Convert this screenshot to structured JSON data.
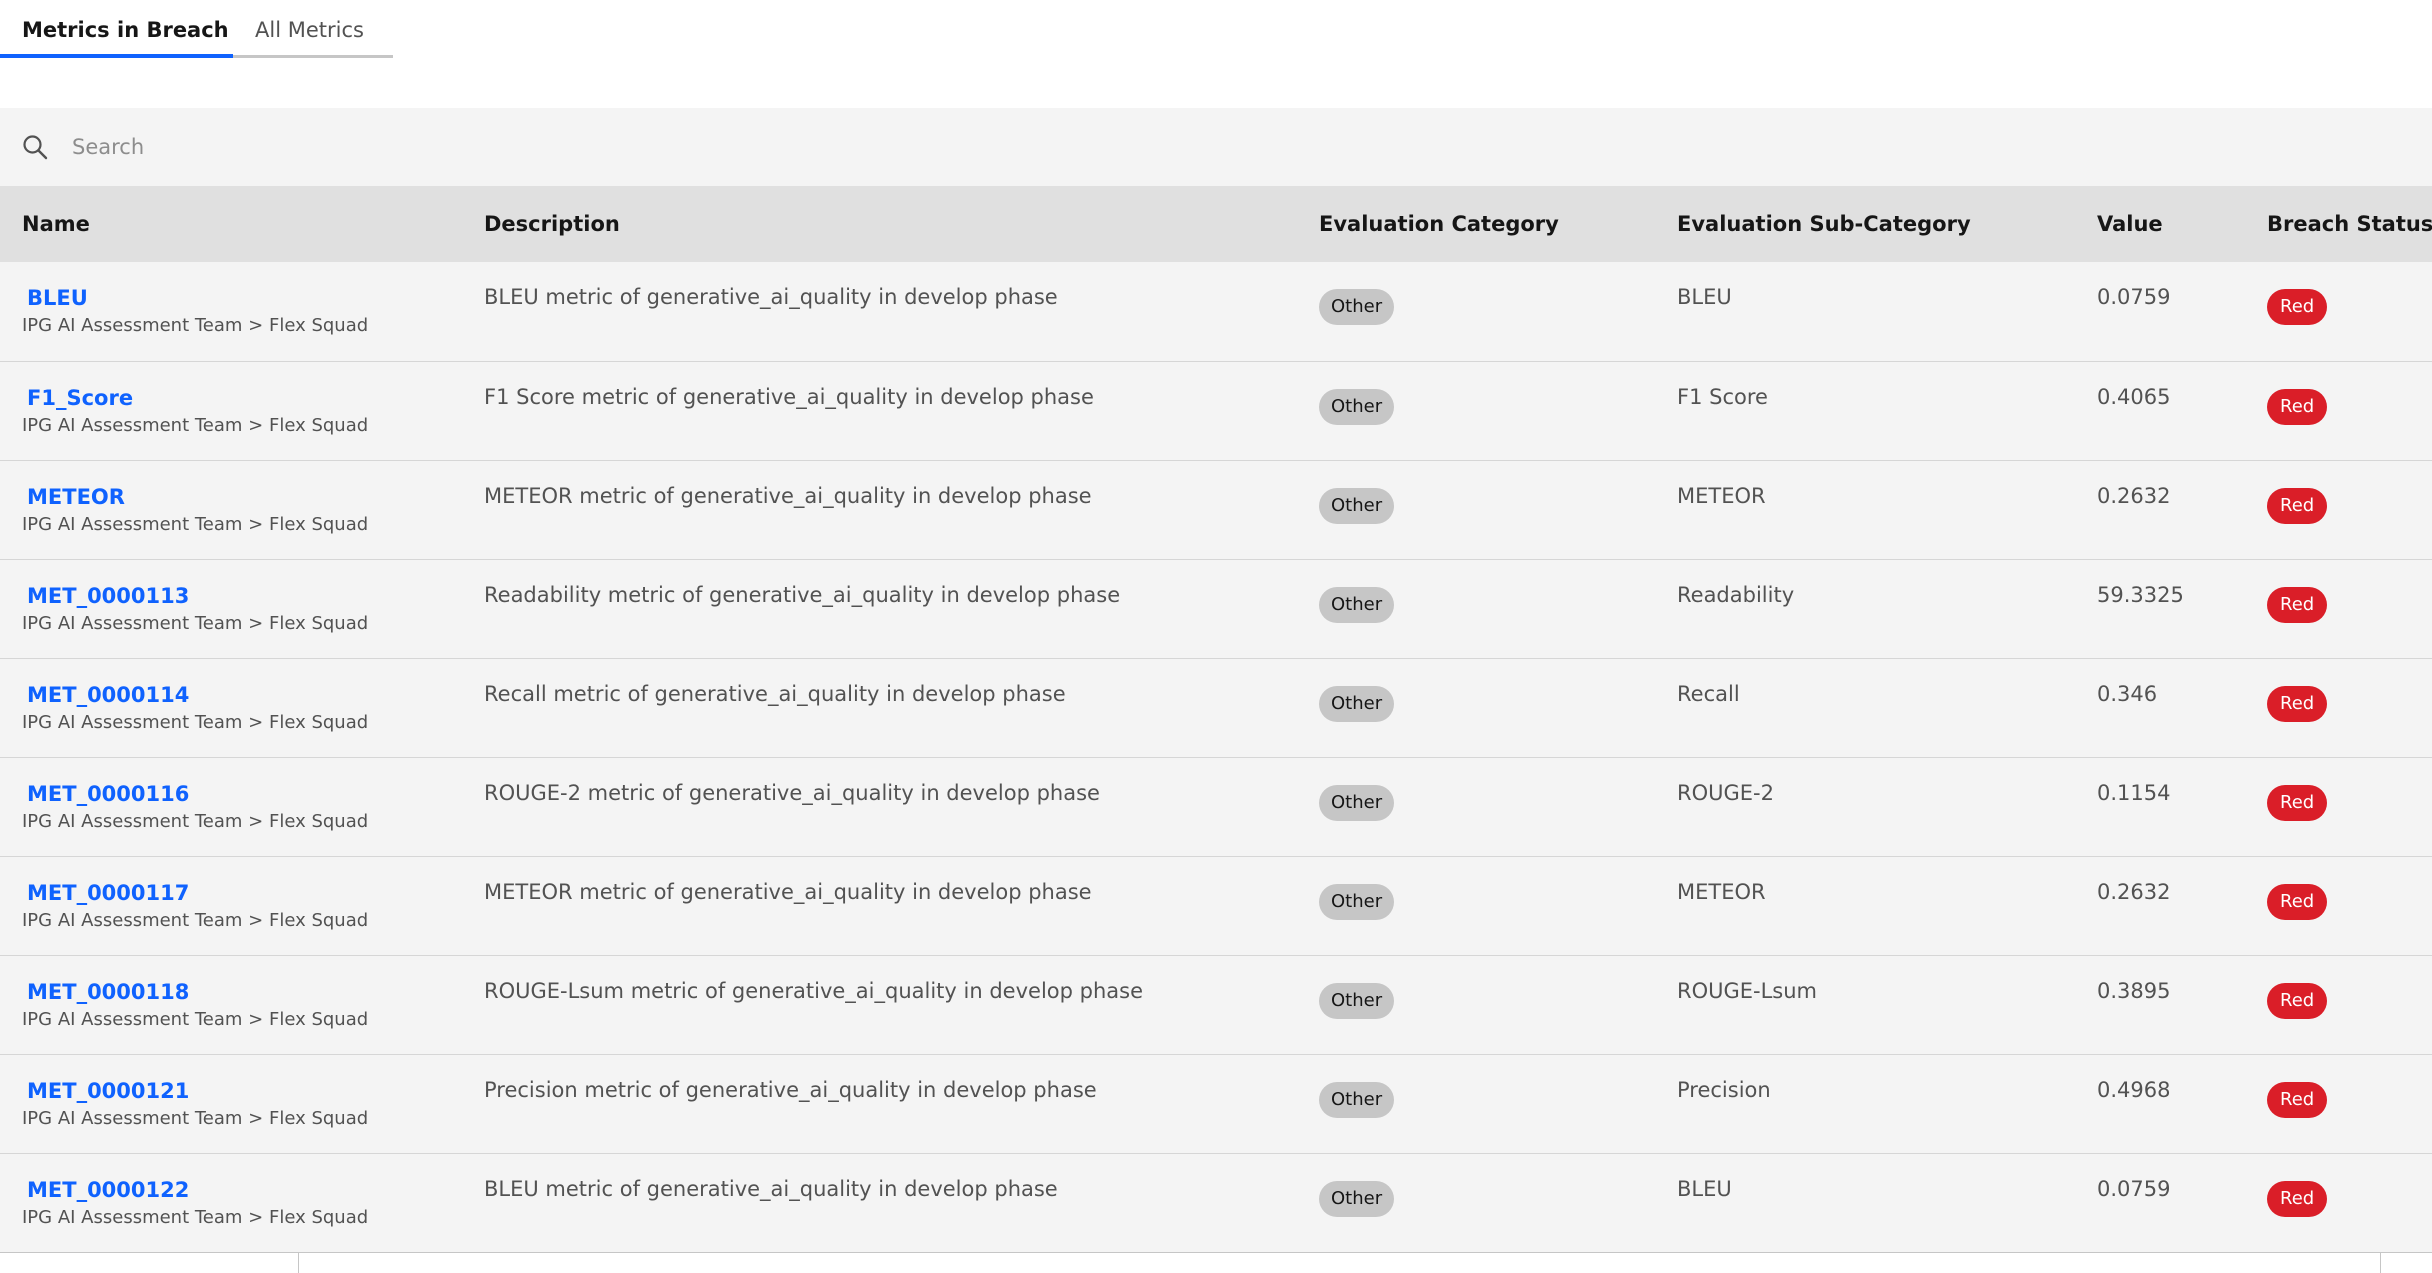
{
  "tabs": [
    {
      "label": "Metrics in Breach",
      "active": true
    },
    {
      "label": "All Metrics",
      "active": false
    }
  ],
  "search": {
    "placeholder": "Search",
    "icon": "search-icon"
  },
  "table": {
    "headers": [
      "Name",
      "Description",
      "Evaluation Category",
      "Evaluation Sub-Category",
      "Value",
      "Breach Status"
    ],
    "rows": [
      {
        "name": "BLEU",
        "owner": "IPG AI Assessment Team > Flex Squad",
        "description": "BLEU metric of generative_ai_quality in develop phase",
        "category": "Other",
        "subcategory": "BLEU",
        "value": "0.0759",
        "status": "Red"
      },
      {
        "name": "F1_Score",
        "owner": "IPG AI Assessment Team > Flex Squad",
        "description": "F1 Score metric of generative_ai_quality in develop phase",
        "category": "Other",
        "subcategory": "F1 Score",
        "value": "0.4065",
        "status": "Red"
      },
      {
        "name": "METEOR",
        "owner": "IPG AI Assessment Team > Flex Squad",
        "description": "METEOR metric of generative_ai_quality in develop phase",
        "category": "Other",
        "subcategory": "METEOR",
        "value": "0.2632",
        "status": "Red"
      },
      {
        "name": "MET_0000113",
        "owner": "IPG AI Assessment Team > Flex Squad",
        "description": "Readability metric of generative_ai_quality in develop phase",
        "category": "Other",
        "subcategory": "Readability",
        "value": "59.3325",
        "status": "Red"
      },
      {
        "name": "MET_0000114",
        "owner": "IPG AI Assessment Team > Flex Squad",
        "description": "Recall metric of generative_ai_quality in develop phase",
        "category": "Other",
        "subcategory": "Recall",
        "value": "0.346",
        "status": "Red"
      },
      {
        "name": "MET_0000116",
        "owner": "IPG AI Assessment Team > Flex Squad",
        "description": "ROUGE-2 metric of generative_ai_quality in develop phase",
        "category": "Other",
        "subcategory": "ROUGE-2",
        "value": "0.1154",
        "status": "Red"
      },
      {
        "name": "MET_0000117",
        "owner": "IPG AI Assessment Team > Flex Squad",
        "description": "METEOR metric of generative_ai_quality in develop phase",
        "category": "Other",
        "subcategory": "METEOR",
        "value": "0.2632",
        "status": "Red"
      },
      {
        "name": "MET_0000118",
        "owner": "IPG AI Assessment Team > Flex Squad",
        "description": "ROUGE-Lsum metric of generative_ai_quality in develop phase",
        "category": "Other",
        "subcategory": "ROUGE-Lsum",
        "value": "0.3895",
        "status": "Red"
      },
      {
        "name": "MET_0000121",
        "owner": "IPG AI Assessment Team > Flex Squad",
        "description": "Precision metric of generative_ai_quality in develop phase",
        "category": "Other",
        "subcategory": "Precision",
        "value": "0.4968",
        "status": "Red"
      },
      {
        "name": "MET_0000122",
        "owner": "IPG AI Assessment Team > Flex Squad",
        "description": "BLEU metric of generative_ai_quality in develop phase",
        "category": "Other",
        "subcategory": "BLEU",
        "value": "0.0759",
        "status": "Red"
      }
    ]
  },
  "colors": {
    "link": "#0f62fe",
    "active_tab_indicator": "#0f62fe",
    "status_red": "#da1e28",
    "category_tag": "#c6c6c6",
    "header_bg": "#e0e0e0",
    "row_bg": "#f4f4f4"
  }
}
